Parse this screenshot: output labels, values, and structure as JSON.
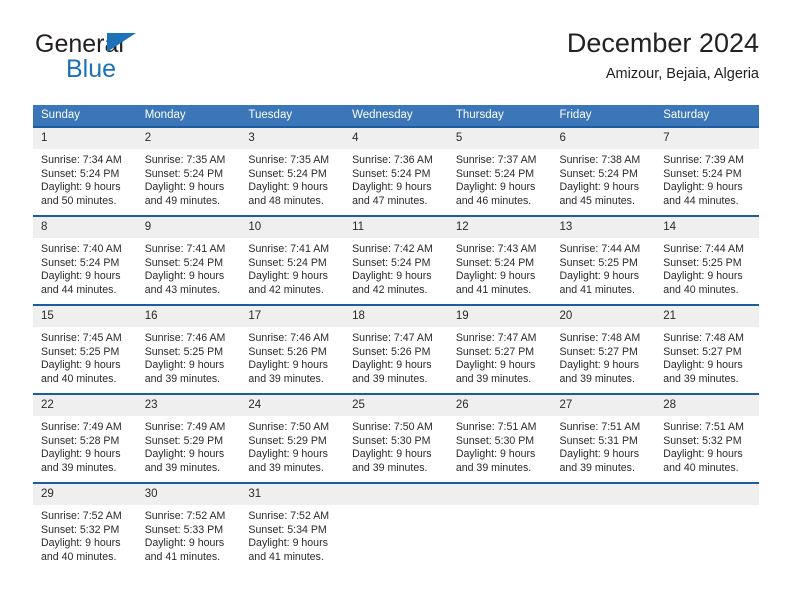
{
  "brand": {
    "name_part1": "General",
    "name_part2": "Blue",
    "triangle_icon": "triangle-icon",
    "color_primary": "#1c72b8",
    "color_text": "#231f20"
  },
  "header": {
    "title": "December 2024",
    "subtitle": "Amizour, Bejaia, Algeria"
  },
  "calendar": {
    "header_bg": "#3a76b8",
    "row_border": "#1c5ca0",
    "daynum_bg": "#efeff0",
    "weekdays": [
      "Sunday",
      "Monday",
      "Tuesday",
      "Wednesday",
      "Thursday",
      "Friday",
      "Saturday"
    ],
    "weeks": [
      [
        {
          "day": "1",
          "sunrise": "Sunrise: 7:34 AM",
          "sunset": "Sunset: 5:24 PM",
          "daylight_1": "Daylight: 9 hours",
          "daylight_2": "and 50 minutes."
        },
        {
          "day": "2",
          "sunrise": "Sunrise: 7:35 AM",
          "sunset": "Sunset: 5:24 PM",
          "daylight_1": "Daylight: 9 hours",
          "daylight_2": "and 49 minutes."
        },
        {
          "day": "3",
          "sunrise": "Sunrise: 7:35 AM",
          "sunset": "Sunset: 5:24 PM",
          "daylight_1": "Daylight: 9 hours",
          "daylight_2": "and 48 minutes."
        },
        {
          "day": "4",
          "sunrise": "Sunrise: 7:36 AM",
          "sunset": "Sunset: 5:24 PM",
          "daylight_1": "Daylight: 9 hours",
          "daylight_2": "and 47 minutes."
        },
        {
          "day": "5",
          "sunrise": "Sunrise: 7:37 AM",
          "sunset": "Sunset: 5:24 PM",
          "daylight_1": "Daylight: 9 hours",
          "daylight_2": "and 46 minutes."
        },
        {
          "day": "6",
          "sunrise": "Sunrise: 7:38 AM",
          "sunset": "Sunset: 5:24 PM",
          "daylight_1": "Daylight: 9 hours",
          "daylight_2": "and 45 minutes."
        },
        {
          "day": "7",
          "sunrise": "Sunrise: 7:39 AM",
          "sunset": "Sunset: 5:24 PM",
          "daylight_1": "Daylight: 9 hours",
          "daylight_2": "and 44 minutes."
        }
      ],
      [
        {
          "day": "8",
          "sunrise": "Sunrise: 7:40 AM",
          "sunset": "Sunset: 5:24 PM",
          "daylight_1": "Daylight: 9 hours",
          "daylight_2": "and 44 minutes."
        },
        {
          "day": "9",
          "sunrise": "Sunrise: 7:41 AM",
          "sunset": "Sunset: 5:24 PM",
          "daylight_1": "Daylight: 9 hours",
          "daylight_2": "and 43 minutes."
        },
        {
          "day": "10",
          "sunrise": "Sunrise: 7:41 AM",
          "sunset": "Sunset: 5:24 PM",
          "daylight_1": "Daylight: 9 hours",
          "daylight_2": "and 42 minutes."
        },
        {
          "day": "11",
          "sunrise": "Sunrise: 7:42 AM",
          "sunset": "Sunset: 5:24 PM",
          "daylight_1": "Daylight: 9 hours",
          "daylight_2": "and 42 minutes."
        },
        {
          "day": "12",
          "sunrise": "Sunrise: 7:43 AM",
          "sunset": "Sunset: 5:24 PM",
          "daylight_1": "Daylight: 9 hours",
          "daylight_2": "and 41 minutes."
        },
        {
          "day": "13",
          "sunrise": "Sunrise: 7:44 AM",
          "sunset": "Sunset: 5:25 PM",
          "daylight_1": "Daylight: 9 hours",
          "daylight_2": "and 41 minutes."
        },
        {
          "day": "14",
          "sunrise": "Sunrise: 7:44 AM",
          "sunset": "Sunset: 5:25 PM",
          "daylight_1": "Daylight: 9 hours",
          "daylight_2": "and 40 minutes."
        }
      ],
      [
        {
          "day": "15",
          "sunrise": "Sunrise: 7:45 AM",
          "sunset": "Sunset: 5:25 PM",
          "daylight_1": "Daylight: 9 hours",
          "daylight_2": "and 40 minutes."
        },
        {
          "day": "16",
          "sunrise": "Sunrise: 7:46 AM",
          "sunset": "Sunset: 5:25 PM",
          "daylight_1": "Daylight: 9 hours",
          "daylight_2": "and 39 minutes."
        },
        {
          "day": "17",
          "sunrise": "Sunrise: 7:46 AM",
          "sunset": "Sunset: 5:26 PM",
          "daylight_1": "Daylight: 9 hours",
          "daylight_2": "and 39 minutes."
        },
        {
          "day": "18",
          "sunrise": "Sunrise: 7:47 AM",
          "sunset": "Sunset: 5:26 PM",
          "daylight_1": "Daylight: 9 hours",
          "daylight_2": "and 39 minutes."
        },
        {
          "day": "19",
          "sunrise": "Sunrise: 7:47 AM",
          "sunset": "Sunset: 5:27 PM",
          "daylight_1": "Daylight: 9 hours",
          "daylight_2": "and 39 minutes."
        },
        {
          "day": "20",
          "sunrise": "Sunrise: 7:48 AM",
          "sunset": "Sunset: 5:27 PM",
          "daylight_1": "Daylight: 9 hours",
          "daylight_2": "and 39 minutes."
        },
        {
          "day": "21",
          "sunrise": "Sunrise: 7:48 AM",
          "sunset": "Sunset: 5:27 PM",
          "daylight_1": "Daylight: 9 hours",
          "daylight_2": "and 39 minutes."
        }
      ],
      [
        {
          "day": "22",
          "sunrise": "Sunrise: 7:49 AM",
          "sunset": "Sunset: 5:28 PM",
          "daylight_1": "Daylight: 9 hours",
          "daylight_2": "and 39 minutes."
        },
        {
          "day": "23",
          "sunrise": "Sunrise: 7:49 AM",
          "sunset": "Sunset: 5:29 PM",
          "daylight_1": "Daylight: 9 hours",
          "daylight_2": "and 39 minutes."
        },
        {
          "day": "24",
          "sunrise": "Sunrise: 7:50 AM",
          "sunset": "Sunset: 5:29 PM",
          "daylight_1": "Daylight: 9 hours",
          "daylight_2": "and 39 minutes."
        },
        {
          "day": "25",
          "sunrise": "Sunrise: 7:50 AM",
          "sunset": "Sunset: 5:30 PM",
          "daylight_1": "Daylight: 9 hours",
          "daylight_2": "and 39 minutes."
        },
        {
          "day": "26",
          "sunrise": "Sunrise: 7:51 AM",
          "sunset": "Sunset: 5:30 PM",
          "daylight_1": "Daylight: 9 hours",
          "daylight_2": "and 39 minutes."
        },
        {
          "day": "27",
          "sunrise": "Sunrise: 7:51 AM",
          "sunset": "Sunset: 5:31 PM",
          "daylight_1": "Daylight: 9 hours",
          "daylight_2": "and 39 minutes."
        },
        {
          "day": "28",
          "sunrise": "Sunrise: 7:51 AM",
          "sunset": "Sunset: 5:32 PM",
          "daylight_1": "Daylight: 9 hours",
          "daylight_2": "and 40 minutes."
        }
      ],
      [
        {
          "day": "29",
          "sunrise": "Sunrise: 7:52 AM",
          "sunset": "Sunset: 5:32 PM",
          "daylight_1": "Daylight: 9 hours",
          "daylight_2": "and 40 minutes."
        },
        {
          "day": "30",
          "sunrise": "Sunrise: 7:52 AM",
          "sunset": "Sunset: 5:33 PM",
          "daylight_1": "Daylight: 9 hours",
          "daylight_2": "and 41 minutes."
        },
        {
          "day": "31",
          "sunrise": "Sunrise: 7:52 AM",
          "sunset": "Sunset: 5:34 PM",
          "daylight_1": "Daylight: 9 hours",
          "daylight_2": "and 41 minutes."
        },
        {
          "day": "",
          "sunrise": "",
          "sunset": "",
          "daylight_1": "",
          "daylight_2": ""
        },
        {
          "day": "",
          "sunrise": "",
          "sunset": "",
          "daylight_1": "",
          "daylight_2": ""
        },
        {
          "day": "",
          "sunrise": "",
          "sunset": "",
          "daylight_1": "",
          "daylight_2": ""
        },
        {
          "day": "",
          "sunrise": "",
          "sunset": "",
          "daylight_1": "",
          "daylight_2": ""
        }
      ]
    ]
  }
}
